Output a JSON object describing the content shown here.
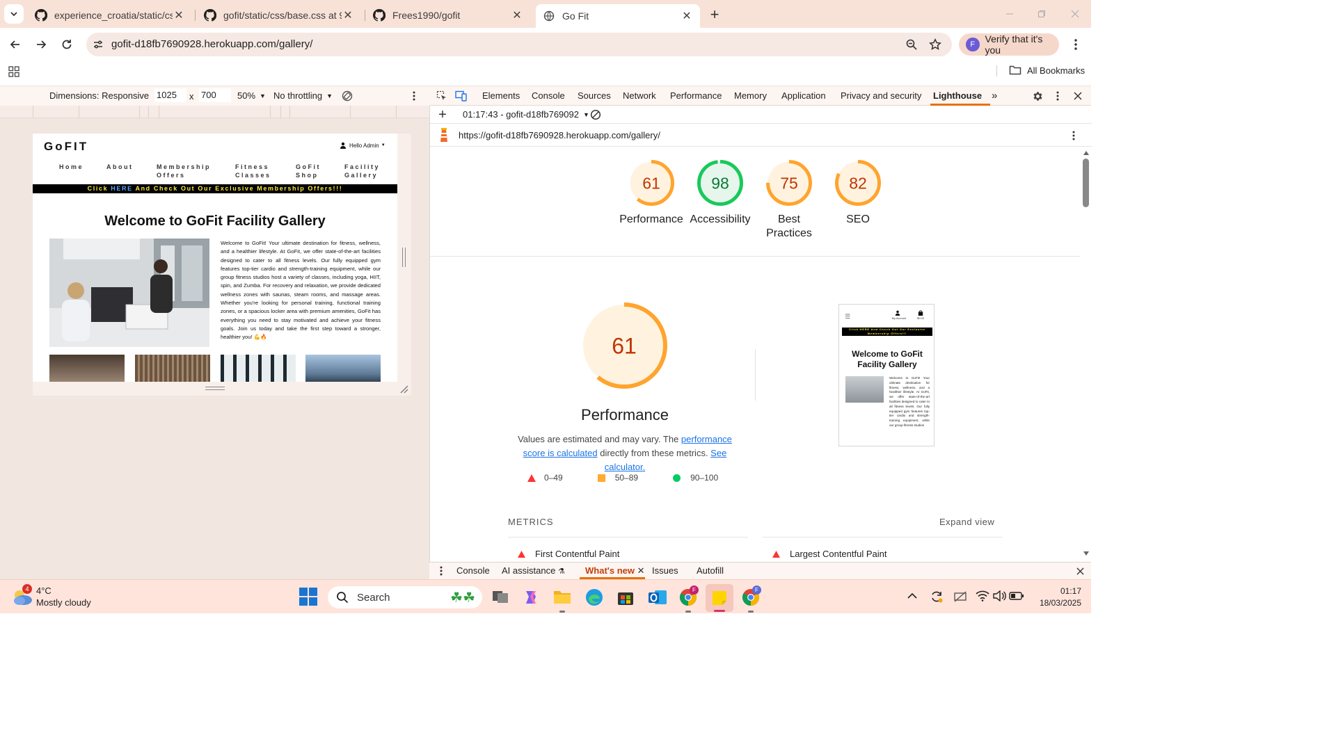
{
  "browser": {
    "tabs": [
      {
        "title": "experience_croatia/static/css/m",
        "icon": "github-icon"
      },
      {
        "title": "gofit/static/css/base.css at 918e",
        "icon": "github-icon"
      },
      {
        "title": "Frees1990/gofit",
        "icon": "github-icon"
      },
      {
        "title": "Go Fit",
        "icon": "globe-icon"
      }
    ],
    "url": "gofit-d18fb7690928.herokuapp.com/gallery/",
    "profile_label": "Verify that it's you",
    "profile_initial": "F",
    "bookmarks_label": "All Bookmarks"
  },
  "device_toolbar": {
    "dimensions_label": "Dimensions: Responsive",
    "width": "1025",
    "times": "x",
    "height": "700",
    "zoom": "50%",
    "throttling": "No throttling"
  },
  "site": {
    "logo": "GoFIT",
    "user_label": "Hello Admin",
    "nav": [
      {
        "line1": "Home",
        "line2": ""
      },
      {
        "line1": "About",
        "line2": ""
      },
      {
        "line1": "Membership",
        "line2": "Offers"
      },
      {
        "line1": "Fitness",
        "line2": "Classes"
      },
      {
        "line1": "GoFit",
        "line2": "Shop"
      },
      {
        "line1": "Facility",
        "line2": "Gallery"
      }
    ],
    "banner_prefix": "Click ",
    "banner_link": "HERE",
    "banner_suffix": " And Check Out Our Exclusive Membership Offers!!!",
    "heading": "Welcome to GoFit Facility Gallery",
    "body_text": "Welcome to GoFit! Your ultimate destination for fitness, wellness, and a healthier lifestyle. At GoFit, we offer state-of-the-art facilities designed to cater to all fitness levels. Our fully equipped gym features top-tier cardio and strength-training equipment, while our group fitness studios host a variety of classes, including yoga, HIIT, spin, and Zumba. For recovery and relaxation, we provide dedicated wellness zones with saunas, steam rooms, and massage areas. Whether you're looking for personal training, functional training zones, or a spacious locker area with premium amenities, GoFit has everything you need to stay motivated and achieve your fitness goals. Join us today and take the first step toward a stronger, healthier you! 💪🔥"
  },
  "devtools": {
    "tabs": [
      "Elements",
      "Console",
      "Sources",
      "Network",
      "Performance",
      "Memory",
      "Application",
      "Privacy and security",
      "Lighthouse"
    ],
    "active_tab": "Lighthouse",
    "report_selector": "01:17:43 - gofit-d18fb769092",
    "report_url": "https://gofit-d18fb7690928.herokuapp.com/gallery/",
    "drawer_tabs": [
      "Console",
      "AI assistance",
      "What's new",
      "Issues",
      "Autofill"
    ],
    "drawer_active": "What's new"
  },
  "lighthouse": {
    "scores": [
      {
        "label": "Performance",
        "value": 61,
        "color": "#e8710a"
      },
      {
        "label": "Accessibility",
        "value": 98,
        "color": "#0c8a3c"
      },
      {
        "label": "Best Practices",
        "value": 75,
        "color": "#e8710a"
      },
      {
        "label": "SEO",
        "value": 82,
        "color": "#e8710a"
      }
    ],
    "main_score": 61,
    "main_label": "Performance",
    "note_prefix": "Values are estimated and may vary. The ",
    "note_link1": "performance score is calculated",
    "note_middle": " directly from these metrics. ",
    "note_link2": "See calculator.",
    "legend": [
      {
        "range": "0–49",
        "color": "#f33"
      },
      {
        "range": "50–89",
        "color": "#fa3"
      },
      {
        "range": "90–100",
        "color": "#0c6"
      }
    ],
    "metrics_title": "METRICS",
    "expand_label": "Expand view",
    "metric_1": "First Contentful Paint",
    "metric_2": "Largest Contentful Paint",
    "thumb": {
      "banner": "Click HERE And Check Out Our Exclusive Membership Offers!!!",
      "heading": "Welcome to GoFit Facility Gallery",
      "account": "My Account",
      "bag": "$0.00",
      "text": "Welcome to GoFit! Your ultimate destination for fitness, wellness, and a healthier lifestyle. At GoFit, we offer state-of-the-art facilities designed to cater to all fitness levels. Our fully equipped gym features top-tier cardio and strength-training equipment, while our group fitness studios"
    }
  },
  "taskbar": {
    "weather_temp": "4°C",
    "weather_desc": "Mostly cloudy",
    "weather_badge": "4",
    "search_label": "Search",
    "time": "01:17",
    "date": "18/03/2025"
  }
}
